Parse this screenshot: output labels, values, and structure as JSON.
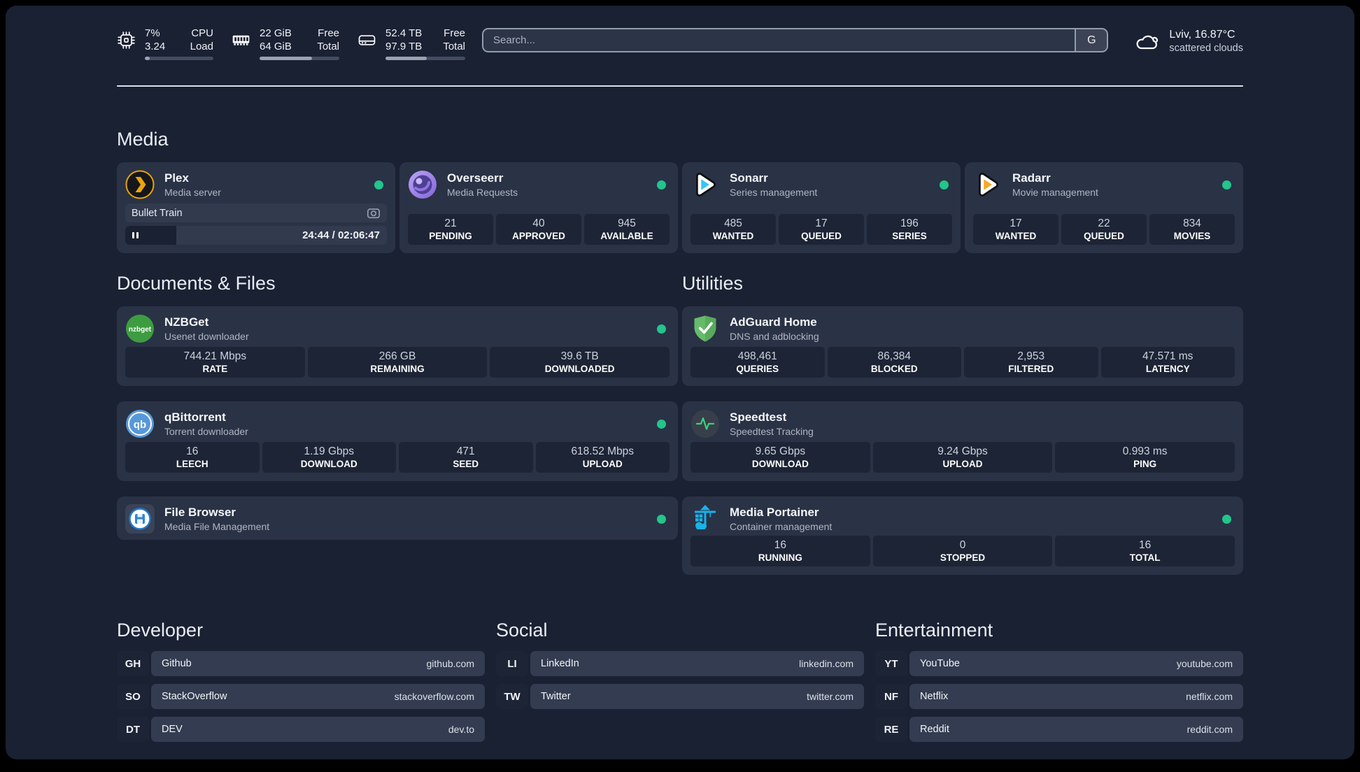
{
  "theme": {
    "background": "#1a2133",
    "card": "#2a3245",
    "stat_box": "#1d2435",
    "status_green": "#22c58b",
    "plex_gold": "#eba50b",
    "sonarr_blue": "#37c6f4",
    "radarr_orange": "#f7a824",
    "portainer_blue": "#18b3e9",
    "adguard_green": "#66bb6a"
  },
  "topbar": {
    "stats": [
      {
        "icon": "cpu-icon",
        "values": [
          "7%",
          "3.24"
        ],
        "labels": [
          "CPU",
          "Load"
        ],
        "progress_pct": 7
      },
      {
        "icon": "memory-icon",
        "values": [
          "22 GiB",
          "64 GiB"
        ],
        "labels": [
          "Free",
          "Total"
        ],
        "progress_pct": 66
      },
      {
        "icon": "disk-icon",
        "values": [
          "52.4 TB",
          "97.9 TB"
        ],
        "labels": [
          "Free",
          "Total"
        ],
        "progress_pct": 52
      }
    ],
    "search": {
      "placeholder": "Search...",
      "engine_button": "G"
    },
    "weather": {
      "icon": "cloud-icon",
      "location_temp": "Lviv, 16.87°C",
      "condition": "scattered clouds"
    }
  },
  "sections": {
    "media": {
      "title": "Media",
      "apps": [
        {
          "name": "Plex",
          "subtitle": "Media server",
          "icon": "plex-icon",
          "online": true,
          "player": {
            "track": "Bullet Train",
            "time": "24:44 / 02:06:47",
            "progress_pct": 19.5
          }
        },
        {
          "name": "Overseerr",
          "subtitle": "Media Requests",
          "icon": "overseerr-icon",
          "online": true,
          "stats": [
            {
              "value": "21",
              "label": "PENDING"
            },
            {
              "value": "40",
              "label": "APPROVED"
            },
            {
              "value": "945",
              "label": "AVAILABLE"
            }
          ]
        },
        {
          "name": "Sonarr",
          "subtitle": "Series management",
          "icon": "sonarr-icon",
          "online": true,
          "stats": [
            {
              "value": "485",
              "label": "WANTED"
            },
            {
              "value": "17",
              "label": "QUEUED"
            },
            {
              "value": "196",
              "label": "SERIES"
            }
          ]
        },
        {
          "name": "Radarr",
          "subtitle": "Movie management",
          "icon": "radarr-icon",
          "online": true,
          "stats": [
            {
              "value": "17",
              "label": "WANTED"
            },
            {
              "value": "22",
              "label": "QUEUED"
            },
            {
              "value": "834",
              "label": "MOVIES"
            }
          ]
        }
      ]
    },
    "documents": {
      "title": "Documents & Files",
      "apps": [
        {
          "name": "NZBGet",
          "subtitle": "Usenet downloader",
          "icon": "nzbget-icon",
          "online": true,
          "stats": [
            {
              "value": "744.21 Mbps",
              "label": "RATE"
            },
            {
              "value": "266 GB",
              "label": "REMAINING"
            },
            {
              "value": "39.6 TB",
              "label": "DOWNLOADED"
            }
          ]
        },
        {
          "name": "qBittorrent",
          "subtitle": "Torrent downloader",
          "icon": "qbittorrent-icon",
          "online": true,
          "stats": [
            {
              "value": "16",
              "label": "LEECH"
            },
            {
              "value": "1.19 Gbps",
              "label": "DOWNLOAD"
            },
            {
              "value": "471",
              "label": "SEED"
            },
            {
              "value": "618.52 Mbps",
              "label": "UPLOAD"
            }
          ]
        },
        {
          "name": "File Browser",
          "subtitle": "Media File Management",
          "icon": "filebrowser-icon",
          "online": true,
          "stats": []
        }
      ]
    },
    "utilities": {
      "title": "Utilities",
      "apps": [
        {
          "name": "AdGuard Home",
          "subtitle": "DNS and adblocking",
          "icon": "adguard-icon",
          "online": false,
          "stats": [
            {
              "value": "498,461",
              "label": "QUERIES"
            },
            {
              "value": "86,384",
              "label": "BLOCKED"
            },
            {
              "value": "2,953",
              "label": "FILTERED"
            },
            {
              "value": "47.571 ms",
              "label": "LATENCY"
            }
          ]
        },
        {
          "name": "Speedtest",
          "subtitle": "Speedtest Tracking",
          "icon": "speedtest-icon",
          "online": false,
          "stats": [
            {
              "value": "9.65 Gbps",
              "label": "DOWNLOAD"
            },
            {
              "value": "9.24 Gbps",
              "label": "UPLOAD"
            },
            {
              "value": "0.993 ms",
              "label": "PING"
            }
          ]
        },
        {
          "name": "Media Portainer",
          "subtitle": "Container management",
          "icon": "portainer-icon",
          "online": true,
          "stats": [
            {
              "value": "16",
              "label": "RUNNING"
            },
            {
              "value": "0",
              "label": "STOPPED"
            },
            {
              "value": "16",
              "label": "TOTAL"
            }
          ]
        }
      ]
    },
    "developer": {
      "title": "Developer",
      "links": [
        {
          "abbr": "GH",
          "name": "Github",
          "url": "github.com"
        },
        {
          "abbr": "SO",
          "name": "StackOverflow",
          "url": "stackoverflow.com"
        },
        {
          "abbr": "DT",
          "name": "DEV",
          "url": "dev.to"
        }
      ]
    },
    "social": {
      "title": "Social",
      "links": [
        {
          "abbr": "LI",
          "name": "LinkedIn",
          "url": "linkedin.com"
        },
        {
          "abbr": "TW",
          "name": "Twitter",
          "url": "twitter.com"
        }
      ]
    },
    "entertainment": {
      "title": "Entertainment",
      "links": [
        {
          "abbr": "YT",
          "name": "YouTube",
          "url": "youtube.com"
        },
        {
          "abbr": "NF",
          "name": "Netflix",
          "url": "netflix.com"
        },
        {
          "abbr": "RE",
          "name": "Reddit",
          "url": "reddit.com"
        }
      ]
    }
  }
}
